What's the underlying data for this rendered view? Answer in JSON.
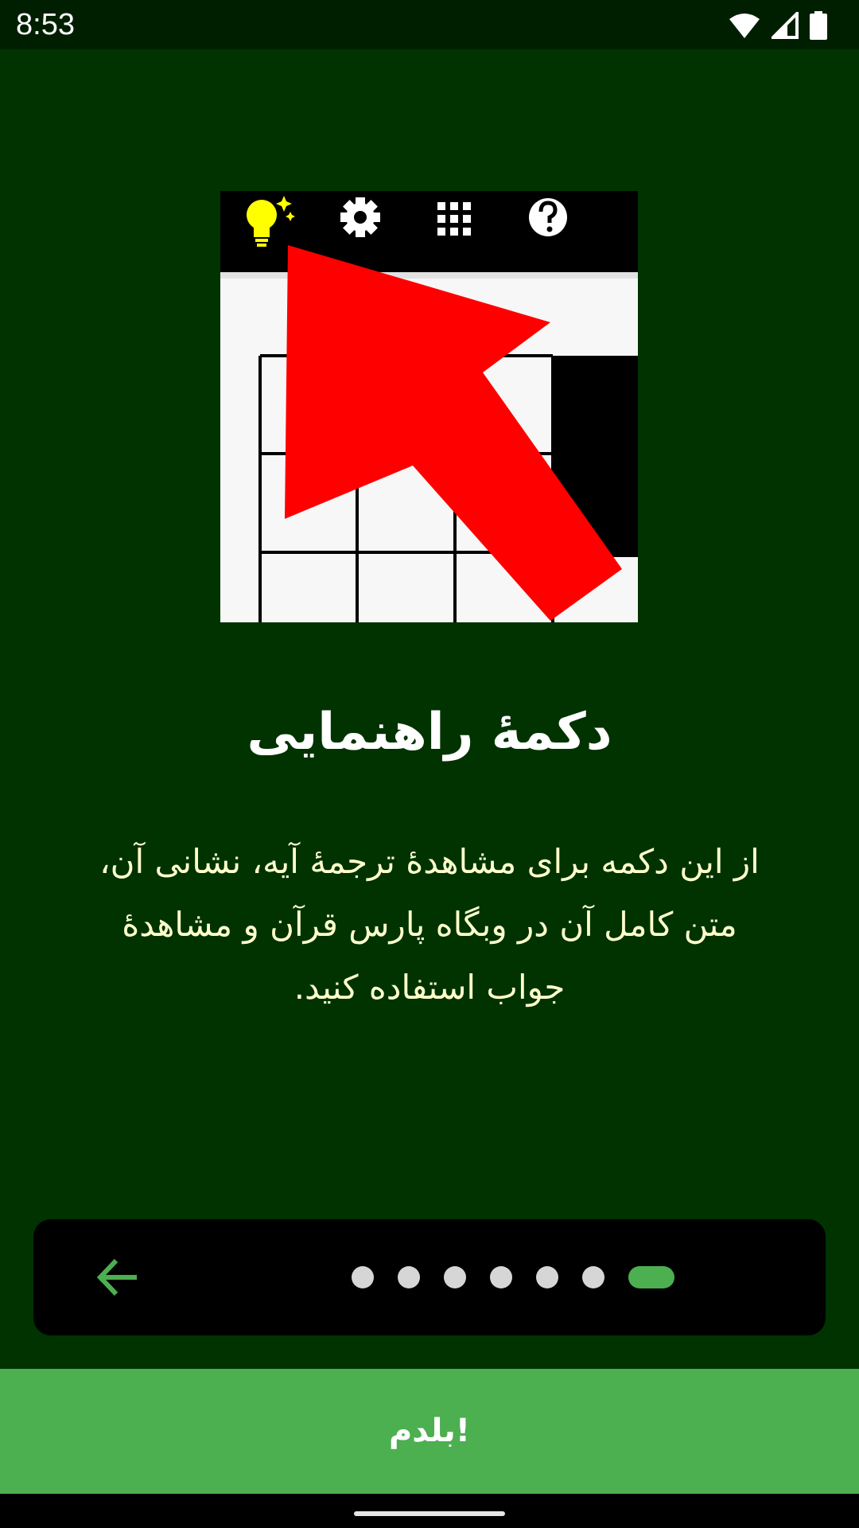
{
  "status_bar": {
    "time": "8:53",
    "icons": [
      "wifi-icon",
      "cell-signal-icon",
      "battery-icon"
    ]
  },
  "tutorial": {
    "image_description_icons": [
      "lightbulb-icon",
      "gear-icon",
      "grid-icon",
      "help-icon"
    ],
    "title": "دکمهٔ راهنمایی",
    "description": "از این دکمه برای مشاهدهٔ ترجمهٔ آیه، نشانی آن، متن کامل آن در وبگاه پارس قرآن و مشاهدهٔ جواب استفاده کنید."
  },
  "pager": {
    "back_icon": "arrow-left-icon",
    "page_count": 7,
    "current_page": 7
  },
  "cta": {
    "label": "بلدم!"
  },
  "colors": {
    "background": "#003300",
    "accent": "#4caf50",
    "description_text": "#ffffcc"
  }
}
